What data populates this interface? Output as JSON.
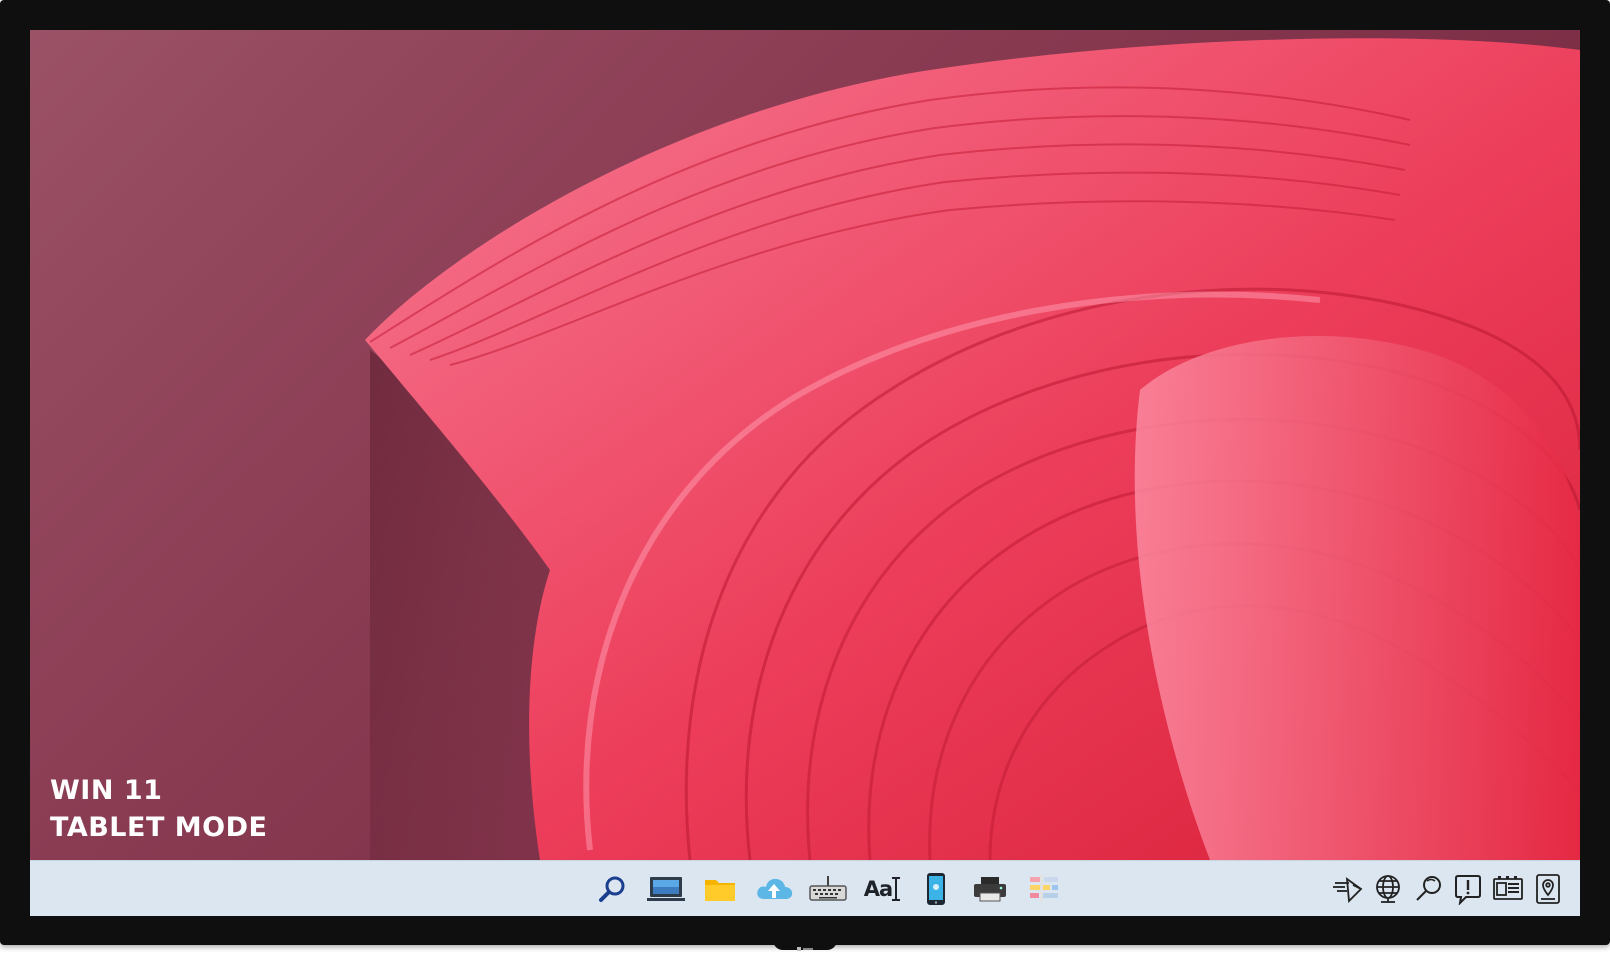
{
  "overlay": {
    "line1": "WIN 11",
    "line2": "TABLET MODE"
  },
  "taskbar": {
    "center_icons": [
      {
        "name": "search-icon"
      },
      {
        "name": "desktop-icon"
      },
      {
        "name": "folder-icon"
      },
      {
        "name": "cloud-upload-icon"
      },
      {
        "name": "touch-keyboard-icon"
      },
      {
        "name": "font-icon",
        "label": "Aa"
      },
      {
        "name": "phone-icon"
      },
      {
        "name": "printer-icon"
      },
      {
        "name": "settings-icon"
      }
    ],
    "tray_icons": [
      {
        "name": "network-transfer-icon"
      },
      {
        "name": "globe-icon"
      },
      {
        "name": "magnifier-icon"
      },
      {
        "name": "notification-alert-icon"
      },
      {
        "name": "news-widget-icon"
      },
      {
        "name": "location-icon"
      }
    ]
  },
  "colors": {
    "wallpaper_base": "#8a3c53",
    "ribbon_red": "#e8304a",
    "ribbon_pink": "#f26b84",
    "taskbar": "#dbe6f1",
    "bezel": "#0f0f10"
  }
}
